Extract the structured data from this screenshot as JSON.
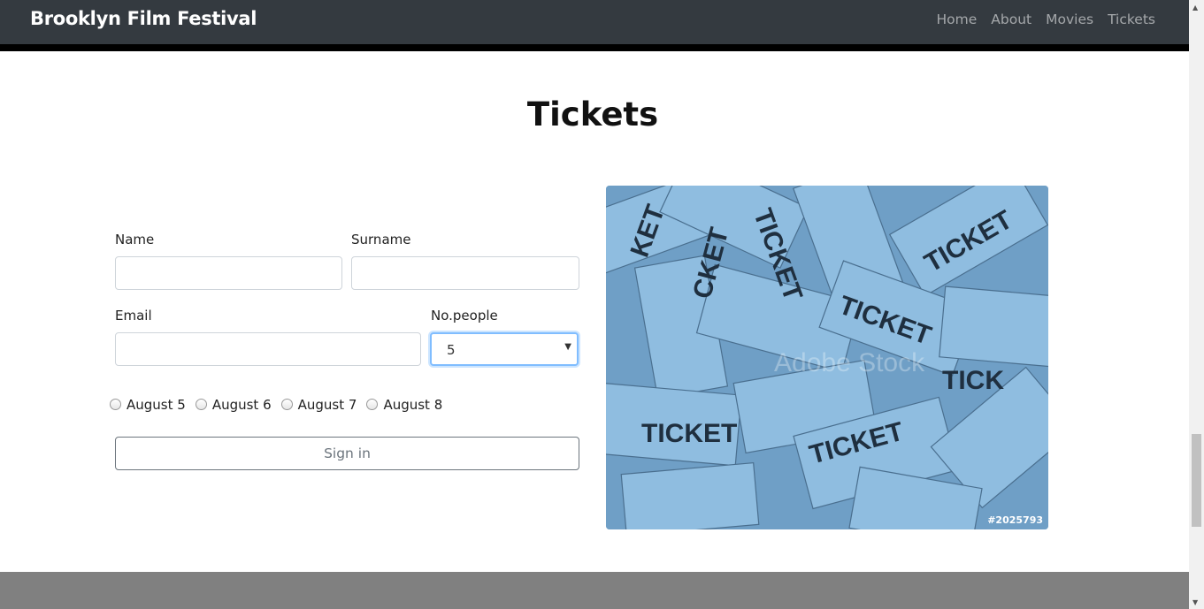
{
  "navbar": {
    "brand": "Brooklyn Film Festival",
    "links": [
      "Home",
      "About",
      "Movies",
      "Tickets"
    ]
  },
  "page": {
    "title": "Tickets"
  },
  "form": {
    "name_label": "Name",
    "name_value": "",
    "surname_label": "Surname",
    "surname_value": "",
    "email_label": "Email",
    "email_value": "",
    "people_label": "No.people",
    "people_value": "5",
    "dates": [
      "August 5",
      "August 6",
      "August 7",
      "August 8"
    ],
    "submit_label": "Sign in"
  },
  "image": {
    "subject": "blue tickets",
    "stock_id": "#2025793"
  },
  "colors": {
    "navbar": "#343a40",
    "footer": "#808080",
    "ticket_blue": "#7fb0d6"
  }
}
